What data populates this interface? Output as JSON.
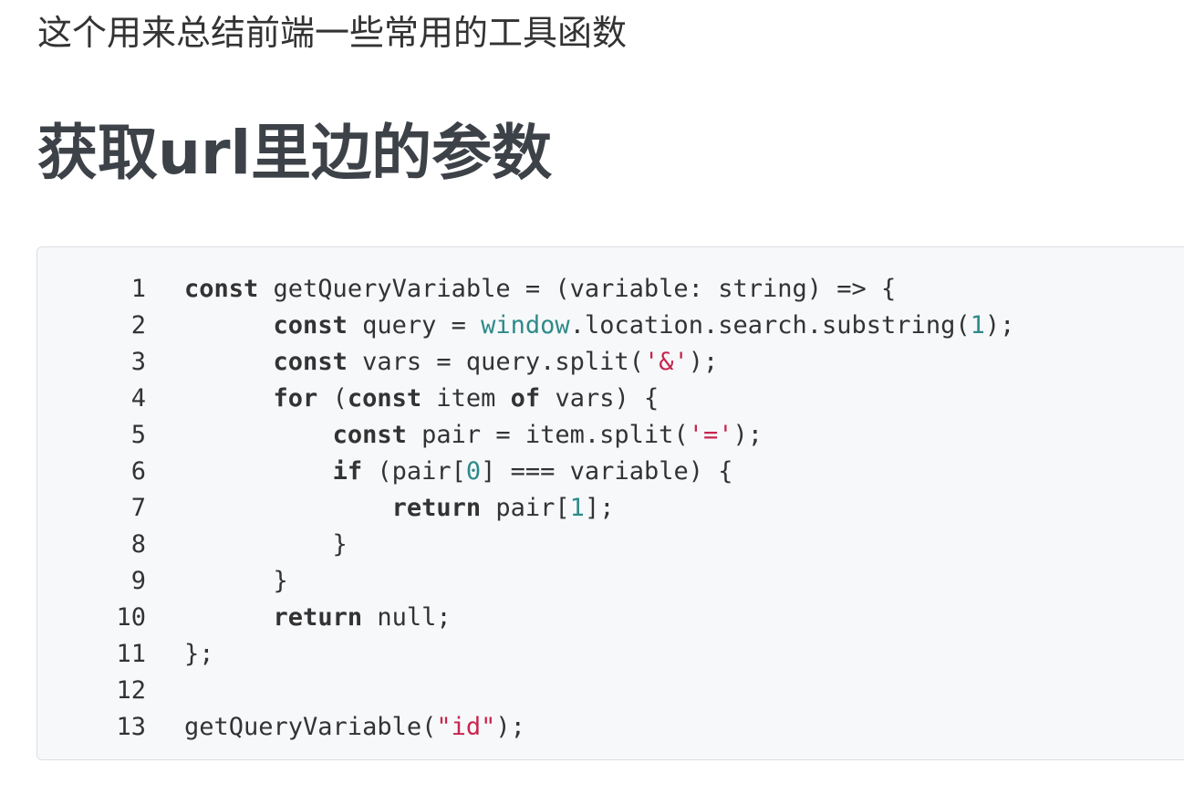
{
  "intro_text": "这个用来总结前端一些常用的工具函数",
  "section_heading": "获取url里边的参数",
  "code": {
    "language": "typescript",
    "colors": {
      "background": "#f7f8fa",
      "border": "#dcdee2",
      "keyword": "#333333",
      "builtin": "#2e8a8a",
      "number": "#2e8a8a",
      "string": "#c7254e"
    },
    "lines": [
      {
        "n": "1",
        "tokens": [
          {
            "t": "kw",
            "v": "const"
          },
          {
            "t": "plain",
            "v": " getQueryVariable = (variable: string) => {"
          }
        ]
      },
      {
        "n": "2",
        "tokens": [
          {
            "t": "plain",
            "v": "      "
          },
          {
            "t": "kw",
            "v": "const"
          },
          {
            "t": "plain",
            "v": " query = "
          },
          {
            "t": "builtin",
            "v": "window"
          },
          {
            "t": "plain",
            "v": ".location.search.substring("
          },
          {
            "t": "num",
            "v": "1"
          },
          {
            "t": "plain",
            "v": ");"
          }
        ]
      },
      {
        "n": "3",
        "tokens": [
          {
            "t": "plain",
            "v": "      "
          },
          {
            "t": "kw",
            "v": "const"
          },
          {
            "t": "plain",
            "v": " vars = query.split("
          },
          {
            "t": "str",
            "v": "'&'"
          },
          {
            "t": "plain",
            "v": ");"
          }
        ]
      },
      {
        "n": "4",
        "tokens": [
          {
            "t": "plain",
            "v": "      "
          },
          {
            "t": "kw",
            "v": "for"
          },
          {
            "t": "plain",
            "v": " ("
          },
          {
            "t": "kw",
            "v": "const"
          },
          {
            "t": "plain",
            "v": " item "
          },
          {
            "t": "kw",
            "v": "of"
          },
          {
            "t": "plain",
            "v": " vars) {"
          }
        ]
      },
      {
        "n": "5",
        "tokens": [
          {
            "t": "plain",
            "v": "          "
          },
          {
            "t": "kw",
            "v": "const"
          },
          {
            "t": "plain",
            "v": " pair = item.split("
          },
          {
            "t": "str",
            "v": "'='"
          },
          {
            "t": "plain",
            "v": ");"
          }
        ]
      },
      {
        "n": "6",
        "tokens": [
          {
            "t": "plain",
            "v": "          "
          },
          {
            "t": "kw",
            "v": "if"
          },
          {
            "t": "plain",
            "v": " (pair["
          },
          {
            "t": "num",
            "v": "0"
          },
          {
            "t": "plain",
            "v": "] === variable) {"
          }
        ]
      },
      {
        "n": "7",
        "tokens": [
          {
            "t": "plain",
            "v": "              "
          },
          {
            "t": "kw",
            "v": "return"
          },
          {
            "t": "plain",
            "v": " pair["
          },
          {
            "t": "num",
            "v": "1"
          },
          {
            "t": "plain",
            "v": "];"
          }
        ]
      },
      {
        "n": "8",
        "tokens": [
          {
            "t": "plain",
            "v": "          }"
          }
        ]
      },
      {
        "n": "9",
        "tokens": [
          {
            "t": "plain",
            "v": "      }"
          }
        ]
      },
      {
        "n": "10",
        "tokens": [
          {
            "t": "plain",
            "v": "      "
          },
          {
            "t": "kw",
            "v": "return"
          },
          {
            "t": "plain",
            "v": " null;"
          }
        ]
      },
      {
        "n": "11",
        "tokens": [
          {
            "t": "plain",
            "v": "};"
          }
        ]
      },
      {
        "n": "12",
        "tokens": []
      },
      {
        "n": "13",
        "tokens": [
          {
            "t": "plain",
            "v": "getQueryVariable("
          },
          {
            "t": "str",
            "v": "\"id\""
          },
          {
            "t": "plain",
            "v": ");"
          }
        ]
      }
    ]
  }
}
